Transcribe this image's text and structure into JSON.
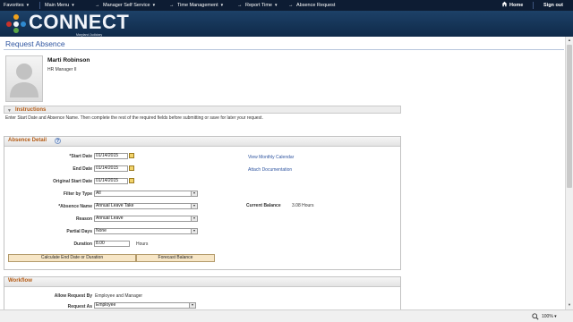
{
  "topnav": {
    "favorites": "Favorites",
    "main_menu": "Main Menu",
    "manager_self_service": "Manager Self Service",
    "time_management": "Time Management",
    "report_time": "Report Time",
    "absence_request": "Absence Request",
    "home": "Home",
    "sign_out": "Sign out",
    "separator": "→",
    "caret": "▾"
  },
  "branding": {
    "logo_text": "CONNECT",
    "logo_subtitle": "Maryland Judiciary"
  },
  "page": {
    "title": "Request Absence"
  },
  "employee": {
    "name": "Marti Robinson",
    "job_title": "HR Manager II"
  },
  "instructions": {
    "header": "Instructions",
    "text": "Enter Start Date and Absence Name. Then complete the rest of the required fields before submitting or save for later your request."
  },
  "absence_detail": {
    "header": "Absence Detail",
    "help": "?",
    "fields": {
      "start_date": {
        "label": "*Start Date",
        "value": "01/14/2015"
      },
      "end_date": {
        "label": "End Date",
        "value": "01/14/2015"
      },
      "original_start_date": {
        "label": "Original Start Date",
        "value": "01/14/2015"
      },
      "filter_by_type": {
        "label": "Filter by Type",
        "value": "All"
      },
      "absence_name": {
        "label": "*Absence Name",
        "value": "Annual Leave Take"
      },
      "reason": {
        "label": "Reason",
        "value": "Annual Leave"
      },
      "partial_days": {
        "label": "Partial Days",
        "value": "None"
      },
      "duration": {
        "label": "Duration",
        "value": "8.00",
        "unit": "Hours"
      }
    },
    "links": {
      "view_monthly_calendar": "View Monthly Calendar",
      "attach_documentation": "Attach Documentation"
    },
    "current_balance": {
      "label": "Current Balance",
      "value": "3.08 Hours"
    },
    "buttons": {
      "calculate": "Calculate End Date or Duration",
      "forecast": "Forecast Balance"
    }
  },
  "workflow": {
    "header": "Workflow",
    "allow_request_by": {
      "label": "Allow Request By",
      "value": "Employee and Manager"
    },
    "request_as": {
      "label": "Request As",
      "value": "Employee"
    }
  },
  "statusbar": {
    "zoom": "100%"
  },
  "colors": {
    "nav_background": "#0d1c33",
    "banner": "#1d4168",
    "section_header_text": "#b35a13",
    "link": "#2f55a0",
    "button_fill": "#f7e6c6"
  }
}
